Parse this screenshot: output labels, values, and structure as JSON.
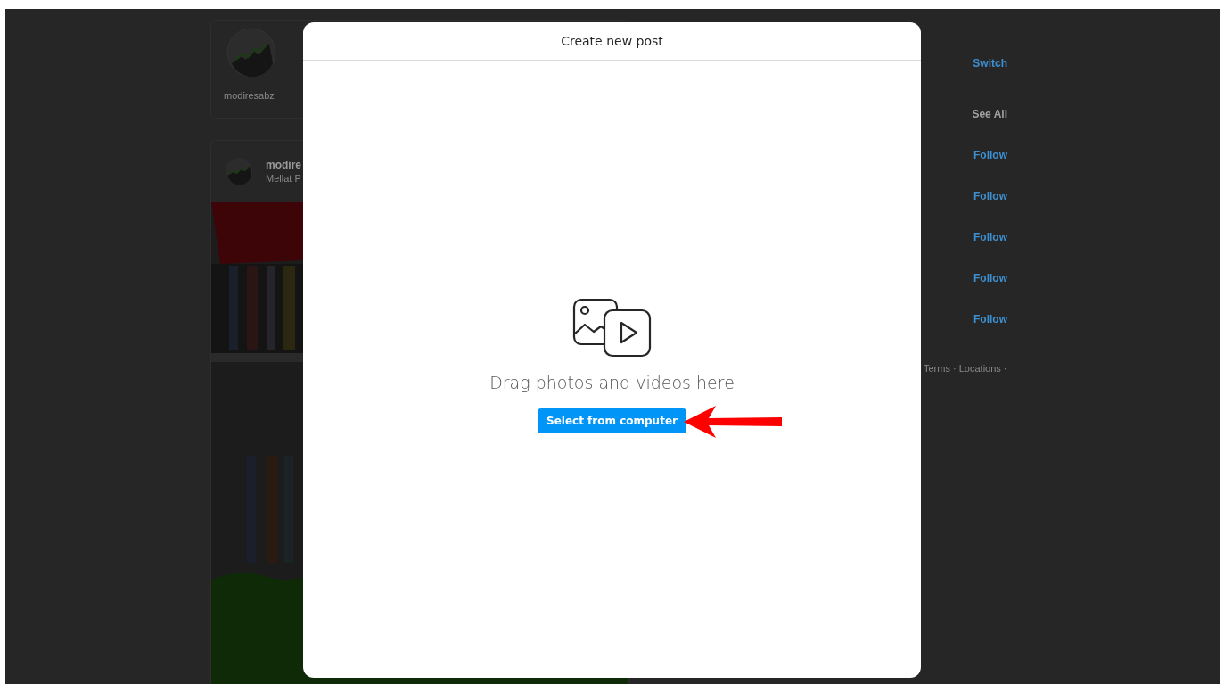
{
  "background": {
    "story": {
      "username": "modiresabz"
    },
    "post": {
      "username": "modire",
      "location": "Mellat P"
    },
    "sidebar": {
      "switch_link": "Switch",
      "see_all": "See All",
      "suggestions": [
        {
          "action": "Follow"
        },
        {
          "action": "Follow"
        },
        {
          "action": "Follow"
        },
        {
          "action": "Follow"
        },
        {
          "action": "Follow"
        }
      ],
      "footer": "Terms · Locations ·"
    }
  },
  "dialog": {
    "title": "Create new post",
    "prompt": "Drag photos and videos here",
    "button": "Select from computer"
  },
  "annotation": {
    "kind": "arrow"
  }
}
